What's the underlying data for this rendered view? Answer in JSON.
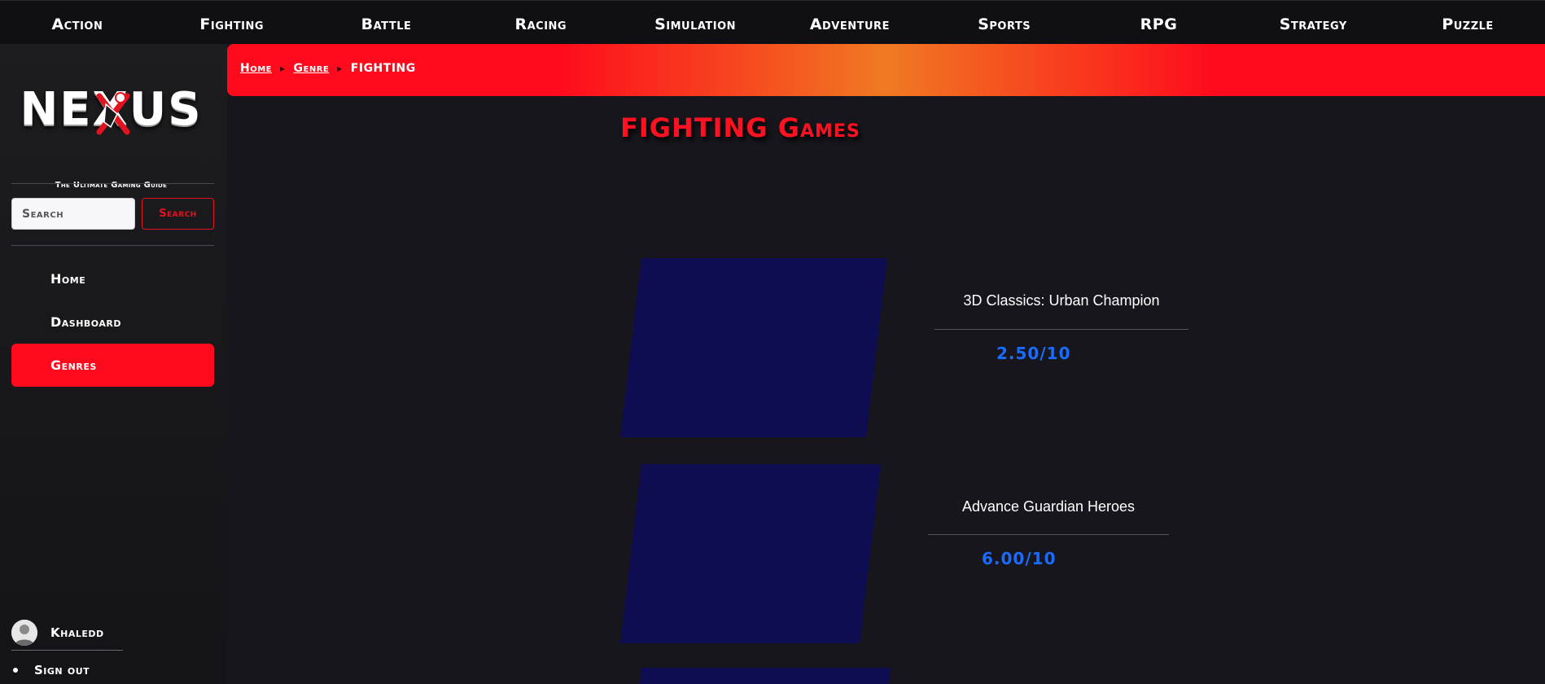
{
  "top_nav": [
    "Action",
    "Fighting",
    "Battle",
    "Racing",
    "Simulation",
    "Adventure",
    "Sports",
    "RPG",
    "Strategy",
    "Puzzle"
  ],
  "logo": {
    "wordmark": "NEXUS",
    "tagline": "The Ultimate Gaming Guide"
  },
  "search": {
    "placeholder": "Search",
    "button_label": "Search"
  },
  "sidebar": {
    "items": [
      {
        "label": "Home",
        "active": false
      },
      {
        "label": "Dashboard",
        "active": false
      },
      {
        "label": "Genres",
        "active": true
      }
    ]
  },
  "user": {
    "name": "Khaledd",
    "signout_label": "Sign out"
  },
  "breadcrumb": {
    "home": "Home",
    "genre": "Genre",
    "current": "FIGHTING"
  },
  "page_title": "FIGHTING Games",
  "games": [
    {
      "title": "3D Classics: Urban Champion",
      "rating": "2.50/10"
    },
    {
      "title": "Advance Guardian Heroes",
      "rating": "6.00/10"
    }
  ],
  "colors": {
    "accent": "#ff0a1c",
    "rating": "#1a6cff",
    "thumb_placeholder": "#0e0d52",
    "background": "#17161c"
  }
}
